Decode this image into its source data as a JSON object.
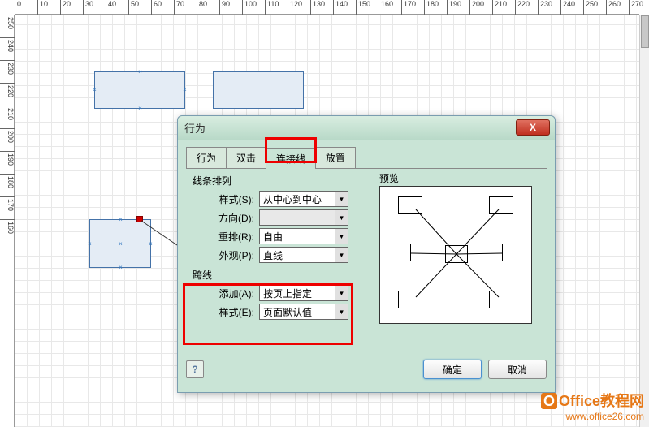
{
  "ruler_h": [
    0,
    10,
    20,
    30,
    40,
    50,
    60,
    70,
    80,
    90,
    100,
    110,
    120,
    130,
    140,
    150,
    160,
    170,
    180,
    190,
    200,
    210,
    220,
    230,
    240,
    250,
    260,
    270
  ],
  "ruler_v": [
    250,
    240,
    230,
    220,
    210,
    200,
    190,
    180,
    170,
    160
  ],
  "dialog": {
    "title": "行为",
    "close": "X",
    "tabs": [
      "行为",
      "双击",
      "连接线",
      "放置"
    ],
    "active_tab": 2,
    "section1_label": "线条排列",
    "fields1": {
      "style_label": "样式(S):",
      "style_value": "从中心到中心",
      "direction_label": "方向(D):",
      "direction_value": "",
      "rearrange_label": "重排(R):",
      "rearrange_value": "自由",
      "appearance_label": "外观(P):",
      "appearance_value": "直线"
    },
    "section2_label": "跨线",
    "fields2": {
      "add_label": "添加(A):",
      "add_value": "按页上指定",
      "style_label": "样式(E):",
      "style_value": "页面默认值"
    },
    "preview_label": "预览",
    "ok": "确定",
    "cancel": "取消",
    "help": "?"
  },
  "watermark": {
    "line1": "Office教程网",
    "line2": "www.office26.com"
  }
}
